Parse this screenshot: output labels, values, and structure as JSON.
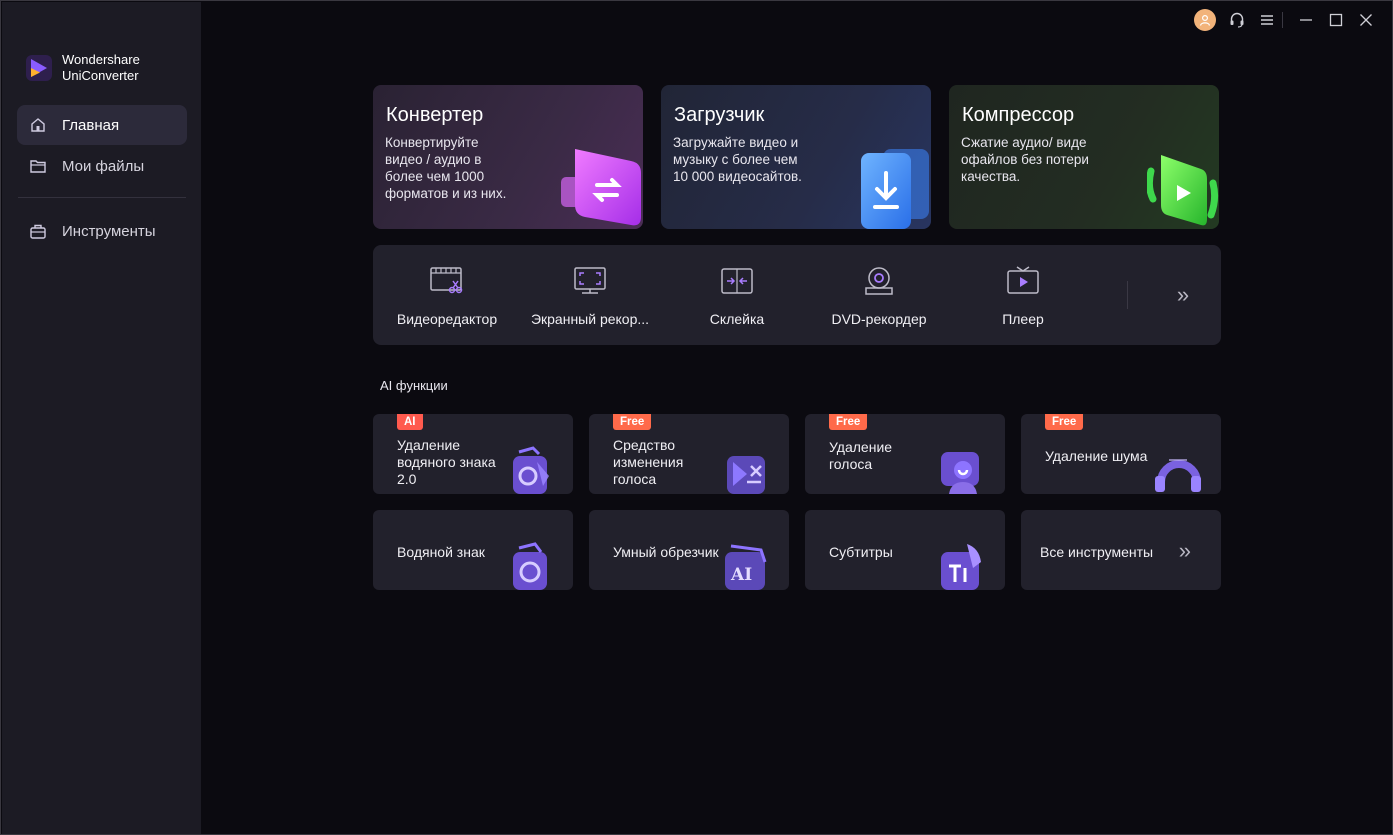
{
  "app": {
    "name_line1": "Wondershare",
    "name_line2": "UniConverter"
  },
  "sidebar": {
    "items": [
      {
        "label": "Главная",
        "icon": "home-icon",
        "active": true
      },
      {
        "label": "Мои файлы",
        "icon": "folder-icon",
        "active": false
      },
      {
        "label": "Инструменты",
        "icon": "toolbox-icon",
        "active": false
      }
    ]
  },
  "titlebar": {
    "icons": [
      "user-avatar-icon",
      "headset-icon",
      "menu-icon",
      "minimize-icon",
      "maximize-icon",
      "close-icon"
    ]
  },
  "feature_cards": [
    {
      "title": "Конвертер",
      "desc": [
        "Конвертируйте",
        "видео / аудио в",
        "более чем 1000",
        "форматов и из них."
      ],
      "accent": "#c24cff"
    },
    {
      "title": "Загрузчик",
      "desc": [
        "Загружайте видео и",
        "музыку с более чем",
        "10 000 видеосайтов."
      ],
      "accent": "#3d8bff"
    },
    {
      "title": "Компрессор",
      "desc": [
        "Сжатие аудио/ виде",
        "офайлов без потери",
        "качества."
      ],
      "accent": "#3ed84c"
    }
  ],
  "tools": [
    {
      "label": "Видеоредактор",
      "icon": "video-editor-icon"
    },
    {
      "label": "Экранный рекор...",
      "icon": "screen-recorder-icon"
    },
    {
      "label": "Склейка",
      "icon": "merge-icon"
    },
    {
      "label": "DVD-рекордер",
      "icon": "dvd-icon"
    },
    {
      "label": "Плеер",
      "icon": "player-icon"
    }
  ],
  "ai_section": {
    "title": "AI функции"
  },
  "ai_cards": [
    {
      "badge": "AI",
      "lines": [
        "Удаление",
        "водяного знака",
        "2.0"
      ],
      "icon": "watermark-remove-icon"
    },
    {
      "badge": "Free",
      "lines": [
        "Средство",
        "изменения",
        "голоса"
      ],
      "icon": "voice-changer-icon"
    },
    {
      "badge": "Free",
      "lines": [
        "Удаление",
        "голоса"
      ],
      "icon": "vocal-remover-icon"
    },
    {
      "badge": "Free",
      "lines": [
        "Удаление шума"
      ],
      "icon": "noise-remover-icon"
    },
    {
      "badge": "",
      "lines": [
        "Водяной знак"
      ],
      "icon": "watermark-icon"
    },
    {
      "badge": "",
      "lines": [
        "Умный обрезчик"
      ],
      "icon": "ai-trimmer-icon"
    },
    {
      "badge": "",
      "lines": [
        "Субтитры"
      ],
      "icon": "subtitles-icon"
    },
    {
      "badge": "",
      "lines": [
        "Все инструменты"
      ],
      "icon": "chevron-right-double-icon"
    }
  ],
  "colors": {
    "sidebar_bg": "#1c1b24",
    "content_bg": "#0b0a10",
    "card_bg": "#22212c",
    "badge": "#ff5a4e",
    "accent": "#8a5cff"
  }
}
